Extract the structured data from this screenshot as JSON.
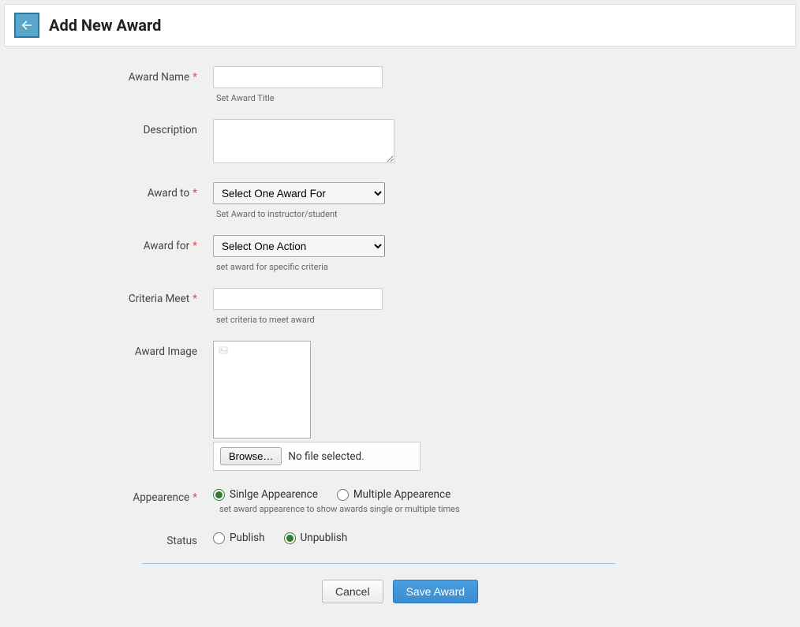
{
  "header": {
    "title": "Add New Award"
  },
  "form": {
    "award_name": {
      "label": "Award Name",
      "required": true,
      "value": "",
      "hint": "Set Award Title"
    },
    "description": {
      "label": "Description",
      "required": false,
      "value": ""
    },
    "award_to": {
      "label": "Award to",
      "required": true,
      "selected": "Select One Award For",
      "hint": "Set Award to instructor/student"
    },
    "award_for": {
      "label": "Award for",
      "required": true,
      "selected": "Select One Action",
      "hint": "set award for specific criteria"
    },
    "criteria_meet": {
      "label": "Criteria Meet",
      "required": true,
      "value": "",
      "hint": "set criteria to meet award"
    },
    "award_image": {
      "label": "Award Image",
      "required": false,
      "browse_label": "Browse…",
      "file_status": "No file selected."
    },
    "appearance": {
      "label": "Appearence",
      "required": true,
      "option_single": "Sinlge Appearence",
      "option_multiple": "Multiple Appearence",
      "hint": "set award appearence to show awards single or multiple times",
      "selected": "single"
    },
    "status": {
      "label": "Status",
      "required": false,
      "option_publish": "Publish",
      "option_unpublish": "Unpublish",
      "selected": "unpublish"
    }
  },
  "actions": {
    "cancel": "Cancel",
    "save": "Save Award"
  }
}
